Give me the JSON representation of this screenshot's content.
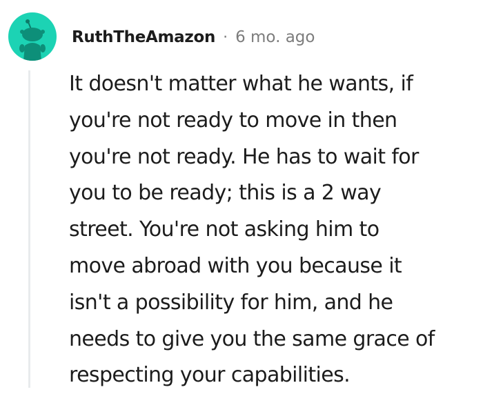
{
  "comment": {
    "author": "RuthTheAmazon",
    "separator": "·",
    "timestamp": "6 mo. ago",
    "avatar_icon": "reddit-snoo-avatar-icon",
    "avatar_color": "#1cd3b4",
    "body_lines": [
      "It doesn't matter what he wants, if",
      "you're not ready to move in then",
      "you're not ready. He has to wait for",
      "you to be ready; this is a 2 way",
      "street. You're not asking him to",
      "move abroad with you because it",
      "isn't a possibility for him, and he",
      "needs to give you the same grace of",
      "respecting your capabilities."
    ]
  }
}
